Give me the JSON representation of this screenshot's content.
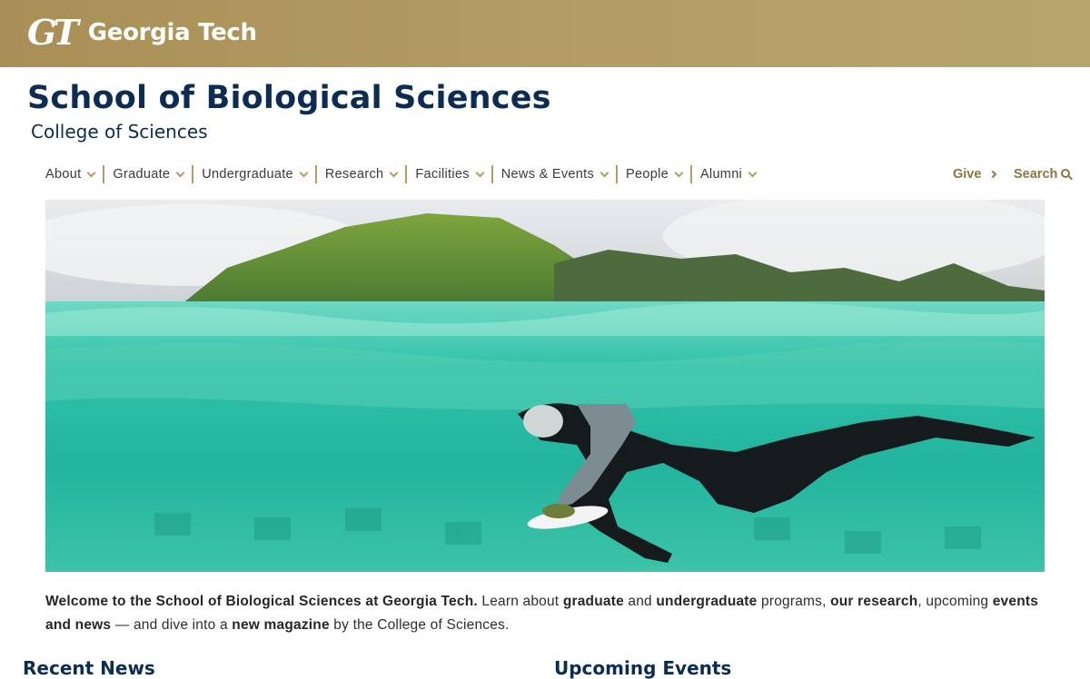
{
  "brand": {
    "logo_mark": "GT",
    "logo_word": "Georgia Tech",
    "colors": {
      "gold": "#b39d64",
      "navy": "#0c2c52",
      "text": "#262626"
    }
  },
  "site": {
    "title": "School of Biological Sciences",
    "subtitle": "College of Sciences"
  },
  "nav": {
    "items": [
      {
        "label": "About"
      },
      {
        "label": "Graduate"
      },
      {
        "label": "Undergraduate"
      },
      {
        "label": "Research"
      },
      {
        "label": "Facilities"
      },
      {
        "label": "News & Events"
      },
      {
        "label": "People"
      },
      {
        "label": "Alumni"
      }
    ],
    "give_label": "Give",
    "search_label": "Search"
  },
  "hero": {
    "icon": "hero-photo-snorkeler"
  },
  "intro": {
    "lead": "Welcome to the School of Biological Sciences at Georgia Tech.",
    "t1": " Learn about ",
    "link_graduate": "graduate",
    "t2": " and ",
    "link_undergraduate": "undergraduate",
    "t3": " programs, ",
    "link_research": "our research",
    "t4": ", upcoming ",
    "link_events": "events and news",
    "t5": " — and dive into a ",
    "link_magazine": "new magazine",
    "t6": " by the College of Sciences."
  },
  "sections": {
    "news_title": "Recent News",
    "events_title": "Upcoming Events"
  }
}
